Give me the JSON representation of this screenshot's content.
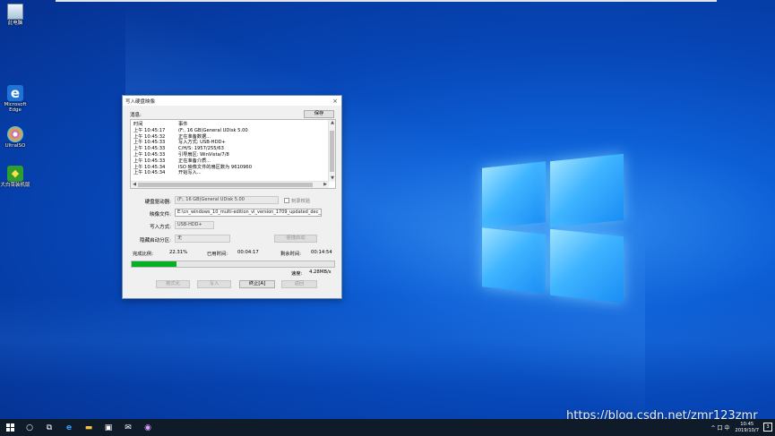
{
  "desktop": {
    "icons": [
      {
        "label": "此电脑",
        "icon": "recycle-bin-icon"
      },
      {
        "label": "Microsoft Edge",
        "icon": "edge-icon"
      },
      {
        "label": "UltraISO",
        "icon": "disc-icon"
      },
      {
        "label": "大白菜装机版",
        "icon": "game-icon"
      }
    ]
  },
  "dialog": {
    "title": "写入硬盘映像",
    "close_glyph": "×",
    "message_label": "消息:",
    "save_label": "保存",
    "log_headers": [
      "时间",
      "事件"
    ],
    "log_rows": [
      [
        "上午 10:45:17",
        "(F:, 16 GB)General UDisk          5.00"
      ],
      [
        "上午 10:45:32",
        "正在准备数据..."
      ],
      [
        "上午 10:45:33",
        "写入方式: USB-HDD+"
      ],
      [
        "上午 10:45:33",
        "C/H/S: 1957/255/63"
      ],
      [
        "上午 10:45:33",
        "引导扇区: WinVista/7/8"
      ],
      [
        "上午 10:45:33",
        "正在准备介质..."
      ],
      [
        "上午 10:45:34",
        "ISO 映像文件的扇区数为 9610960"
      ],
      [
        "上午 10:45:34",
        "开始写入..."
      ]
    ],
    "drive_label": "硬盘驱动器:",
    "drive_value": "(F:, 16 GB)General UDisk        5.00",
    "verify_label": "刻录校验",
    "image_label": "映像文件:",
    "image_value": "E:\\cn_windows_10_multi-edition_vl_version_1709_updated_dec_",
    "write_method_label": "写入方式:",
    "write_method_value": "USB-HDD+",
    "hidden_part_label": "隐藏启动分区:",
    "hidden_part_value": "无",
    "convenient_boot_label": "便捷启动",
    "completed_label": "完成比例:",
    "completed_value": "22.31%",
    "elapsed_label": "已用时间:",
    "elapsed_value": "00:04:17",
    "remaining_label": "剩余时间:",
    "remaining_value": "00:14:54",
    "progress": 0.2231,
    "speed_label": "速度:",
    "speed_value": "4.28MB/s",
    "buttons": {
      "format": "格式化",
      "write": "写入",
      "stop": "终止[A]",
      "back": "返回"
    }
  },
  "taskbar": {
    "clock_time": "10:45",
    "clock_date": "2019/10/7",
    "tray_text": "^ 口 中 ",
    "notification": "3"
  },
  "watermark": "https://blog.csdn.net/zmr123zmr",
  "colors": {
    "progress_fill": "#06b025",
    "taskbar": "#101b2a",
    "desktop": "#0b58cf"
  }
}
